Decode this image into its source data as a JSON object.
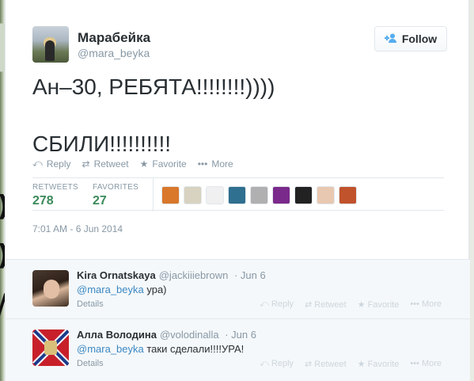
{
  "tweet": {
    "display_name": "Марабейка",
    "handle": "@mara_beyka",
    "follow_label": "Follow",
    "text": "Ан–30, РЕБЯТА!!!!!!!!))))\n\nСБИЛИ!!!!!!!!!!",
    "actions": {
      "reply": "Reply",
      "retweet": "Retweet",
      "favorite": "Favorite",
      "more": "More"
    },
    "stats": {
      "retweets_label": "RETWEETS",
      "retweets_value": "278",
      "favorites_label": "FAVORITES",
      "favorites_value": "27"
    },
    "timestamp": "7:01 AM - 6 Jun 2014"
  },
  "retweeter_faces": [
    "#d9772b",
    "#d8d2c0",
    "#f0f0f0",
    "#2f6f8f",
    "#b0b0b0",
    "#7a2a8a",
    "#222222",
    "#e8c8b0",
    "#c0522c"
  ],
  "replies": [
    {
      "name": "Kira Ornatskaya",
      "handle": "@jackiiiebrown",
      "date": "· Jun 6",
      "mention": "@mara_beyka",
      "text": " ура)",
      "details": "Details",
      "actions": {
        "reply": "Reply",
        "retweet": "Retweet",
        "favorite": "Favorite",
        "more": "More"
      }
    },
    {
      "name": "Алла Володина",
      "handle": "@volodinalla",
      "date": "· Jun 6",
      "mention": "@mara_beyka",
      "text": " таки сделали!!!!УРА!",
      "details": "Details",
      "actions": {
        "reply": "Reply",
        "retweet": "Retweet",
        "favorite": "Favorite",
        "more": "More"
      }
    }
  ],
  "colors": {
    "link": "#3b88c3",
    "stat_number": "#3b8a5a",
    "muted": "#8899a6",
    "follow_icon": "#55acee"
  }
}
